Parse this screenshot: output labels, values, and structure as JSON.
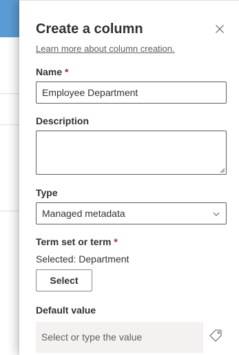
{
  "panel": {
    "title": "Create a column",
    "learn_more_link": "Learn more about column creation."
  },
  "fields": {
    "name": {
      "label": "Name",
      "required_marker": "*",
      "value": "Employee Department"
    },
    "description": {
      "label": "Description",
      "value": ""
    },
    "type": {
      "label": "Type",
      "selected": "Managed metadata"
    },
    "term_set": {
      "label": "Term set or term",
      "required_marker": "*",
      "selected_text": "Selected: Department",
      "button_label": "Select"
    },
    "default_value": {
      "label": "Default value",
      "placeholder": "Select or type the value"
    }
  },
  "icons": {
    "close": "close-icon",
    "dropdown": "chevron-down-icon",
    "tag": "tag-icon"
  },
  "colors": {
    "required": "#a4262c",
    "background_accent": "#5b9bd5",
    "default_input_bg": "#f3f2f1"
  }
}
